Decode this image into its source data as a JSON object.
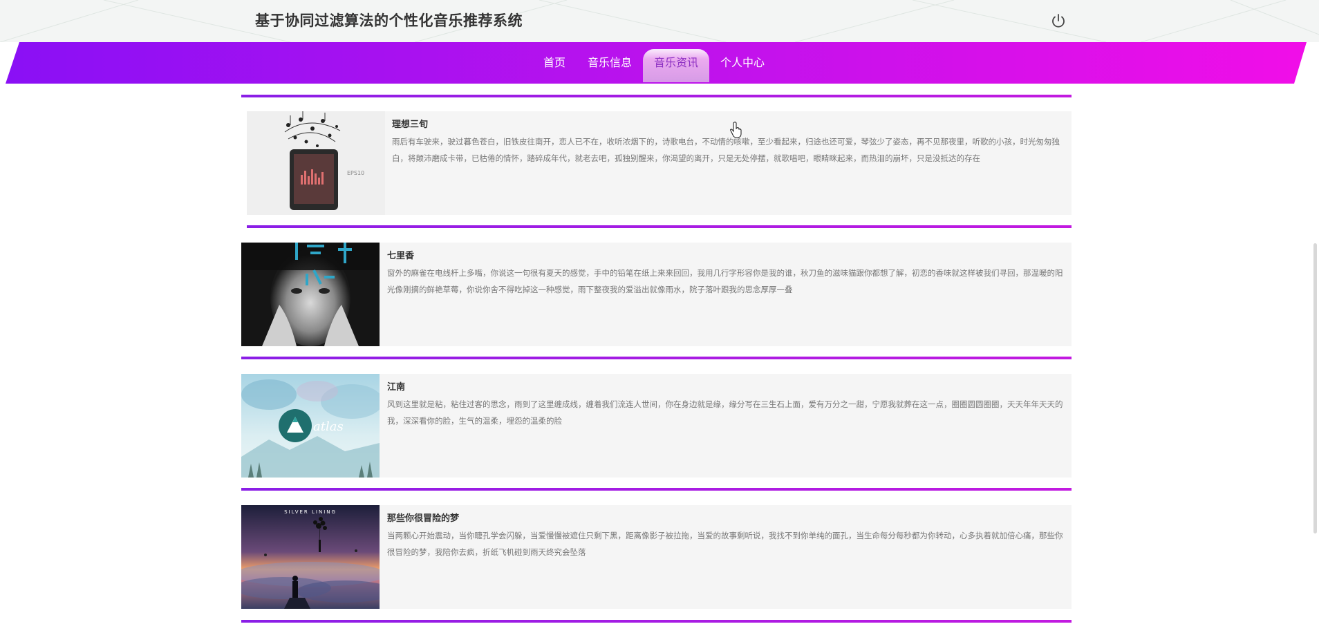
{
  "header": {
    "site_title": "基于协同过滤算法的个性化音乐推荐系统",
    "power_icon": "power-icon"
  },
  "nav": {
    "items": [
      {
        "label": "首页"
      },
      {
        "label": "音乐信息"
      },
      {
        "label": "音乐资讯",
        "active": true
      },
      {
        "label": "个人中心"
      }
    ]
  },
  "news": [
    {
      "title": "理想三旬",
      "text": "雨后有车驶来，驶过暮色苍白，旧铁皮往南开，恋人已不在，收听浓烟下的，诗歌电台，不动情的咳嗽，至少看起来，归途也还可爱，琴弦少了姿态，再不见那夜里，听歌的小孩，时光匆匆独白，将颠沛磨成卡带，已枯倦的情怀，踏碎成年代，就老去吧，孤独别醒来，你渴望的离开，只是无处停摆，就歌唱吧，眼睛眯起来，而热泪的崩坏，只是没抵达的存在",
      "image": "tablet-music-notes-image"
    },
    {
      "title": "七里香",
      "text": "窗外的麻雀在电线杆上多嘴，你说这一句很有夏天的感觉，手中的铅笔在纸上来来回回，我用几行字形容你是我的谁，秋刀鱼的滋味猫跟你都想了解，初恋的香味就这样被我们寻回，那温暖的阳光像刚摘的鲜艳草莓，你说你舍不得吃掉这一种感觉，雨下整夜我的爱溢出就像雨水，院子落叶跟我的思念厚厚一叠",
      "image": "portrait-album-cover-image"
    },
    {
      "title": "江南",
      "text": "风到这里就是粘，粘住过客的思念，雨到了这里缠成线，缠着我们流连人世间，你在身边就是缘，缘分写在三生石上面，爱有万分之一甜，宁愿我就葬在这一点，圈圈圆圆圈圈，天天年年天天的我，深深看你的脸，生气的温柔，埋怨的温柔的脸",
      "image": "watercolor-mountain-image"
    },
    {
      "title": "那些你很冒险的梦",
      "text": "当两颗心开始震动，当你睫孔学会闪躲，当爱慢慢被遮住只剩下黑，距离像影子被拉拖，当爱的故事剩听说，我找不到你单纯的面孔，当生命每分每秒都为你转动，心多执着就加倍心痛，那些你很冒险的梦，我陪你去疯，折纸飞机碰到雨天终究会坠落",
      "image": "silver-lining-sunset-image"
    }
  ]
}
